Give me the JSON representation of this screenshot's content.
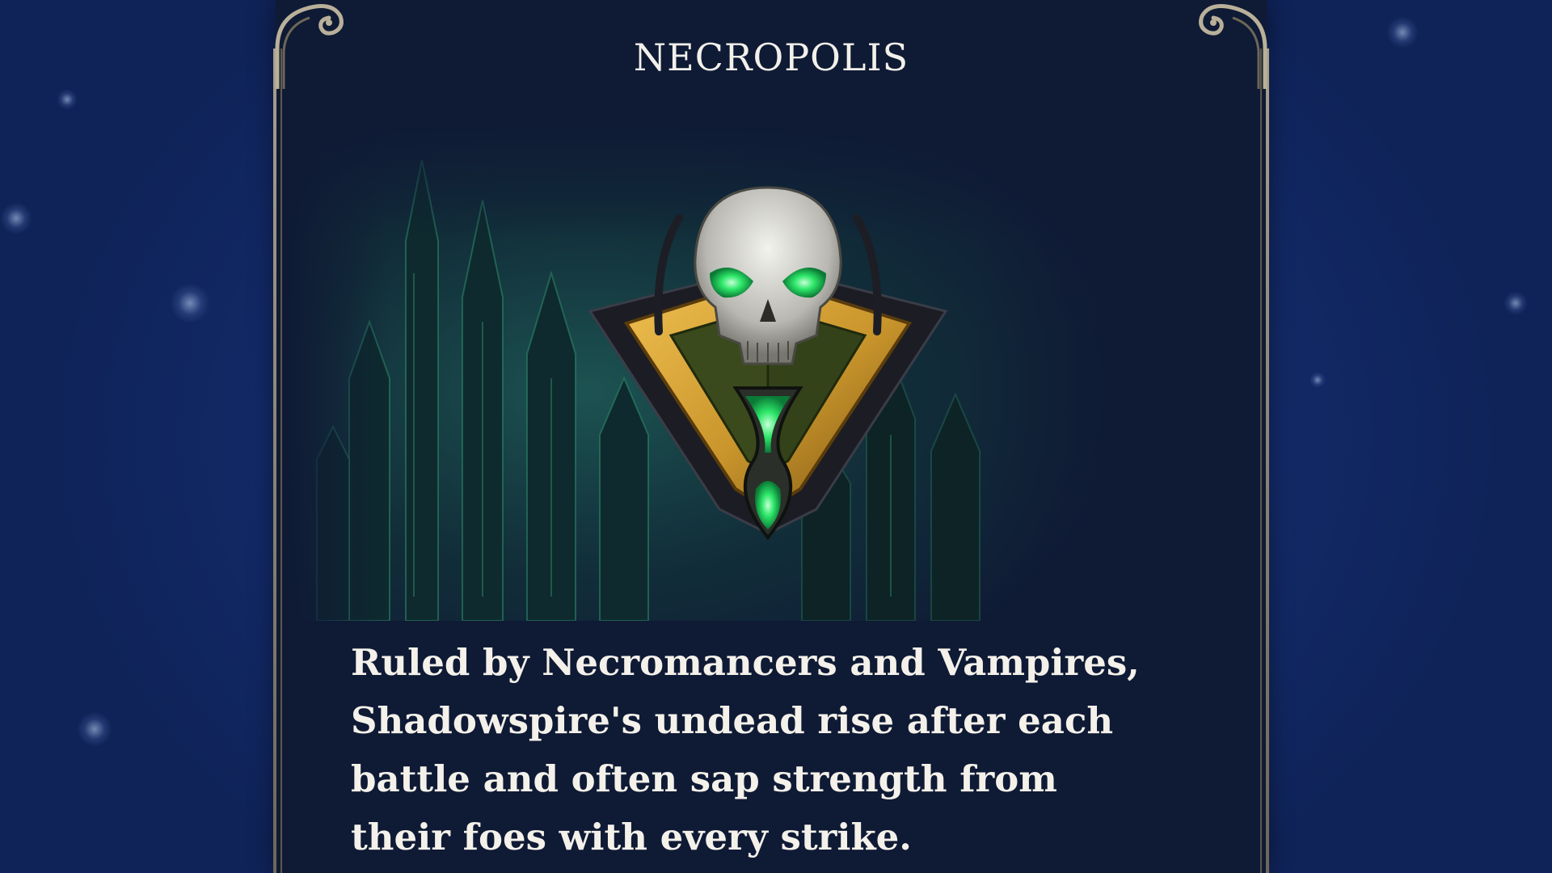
{
  "screen": {
    "faction_title": "NECROPOLIS",
    "description": "Ruled by Necromancers and Vampires, Shadowspire's undead rise after each battle and often sap strength from their foes with every strike."
  },
  "icons": {
    "faction_emblem": "skull-hourglass-emblem",
    "background_art": "gothic-city-artwork"
  },
  "colors": {
    "background": "#142c6e",
    "panel": "#0f1a35",
    "frame": "#a8a08c",
    "emblem_gold": "#c9952c",
    "emblem_green": "#2ee86a",
    "text": "#f4f1ea"
  }
}
